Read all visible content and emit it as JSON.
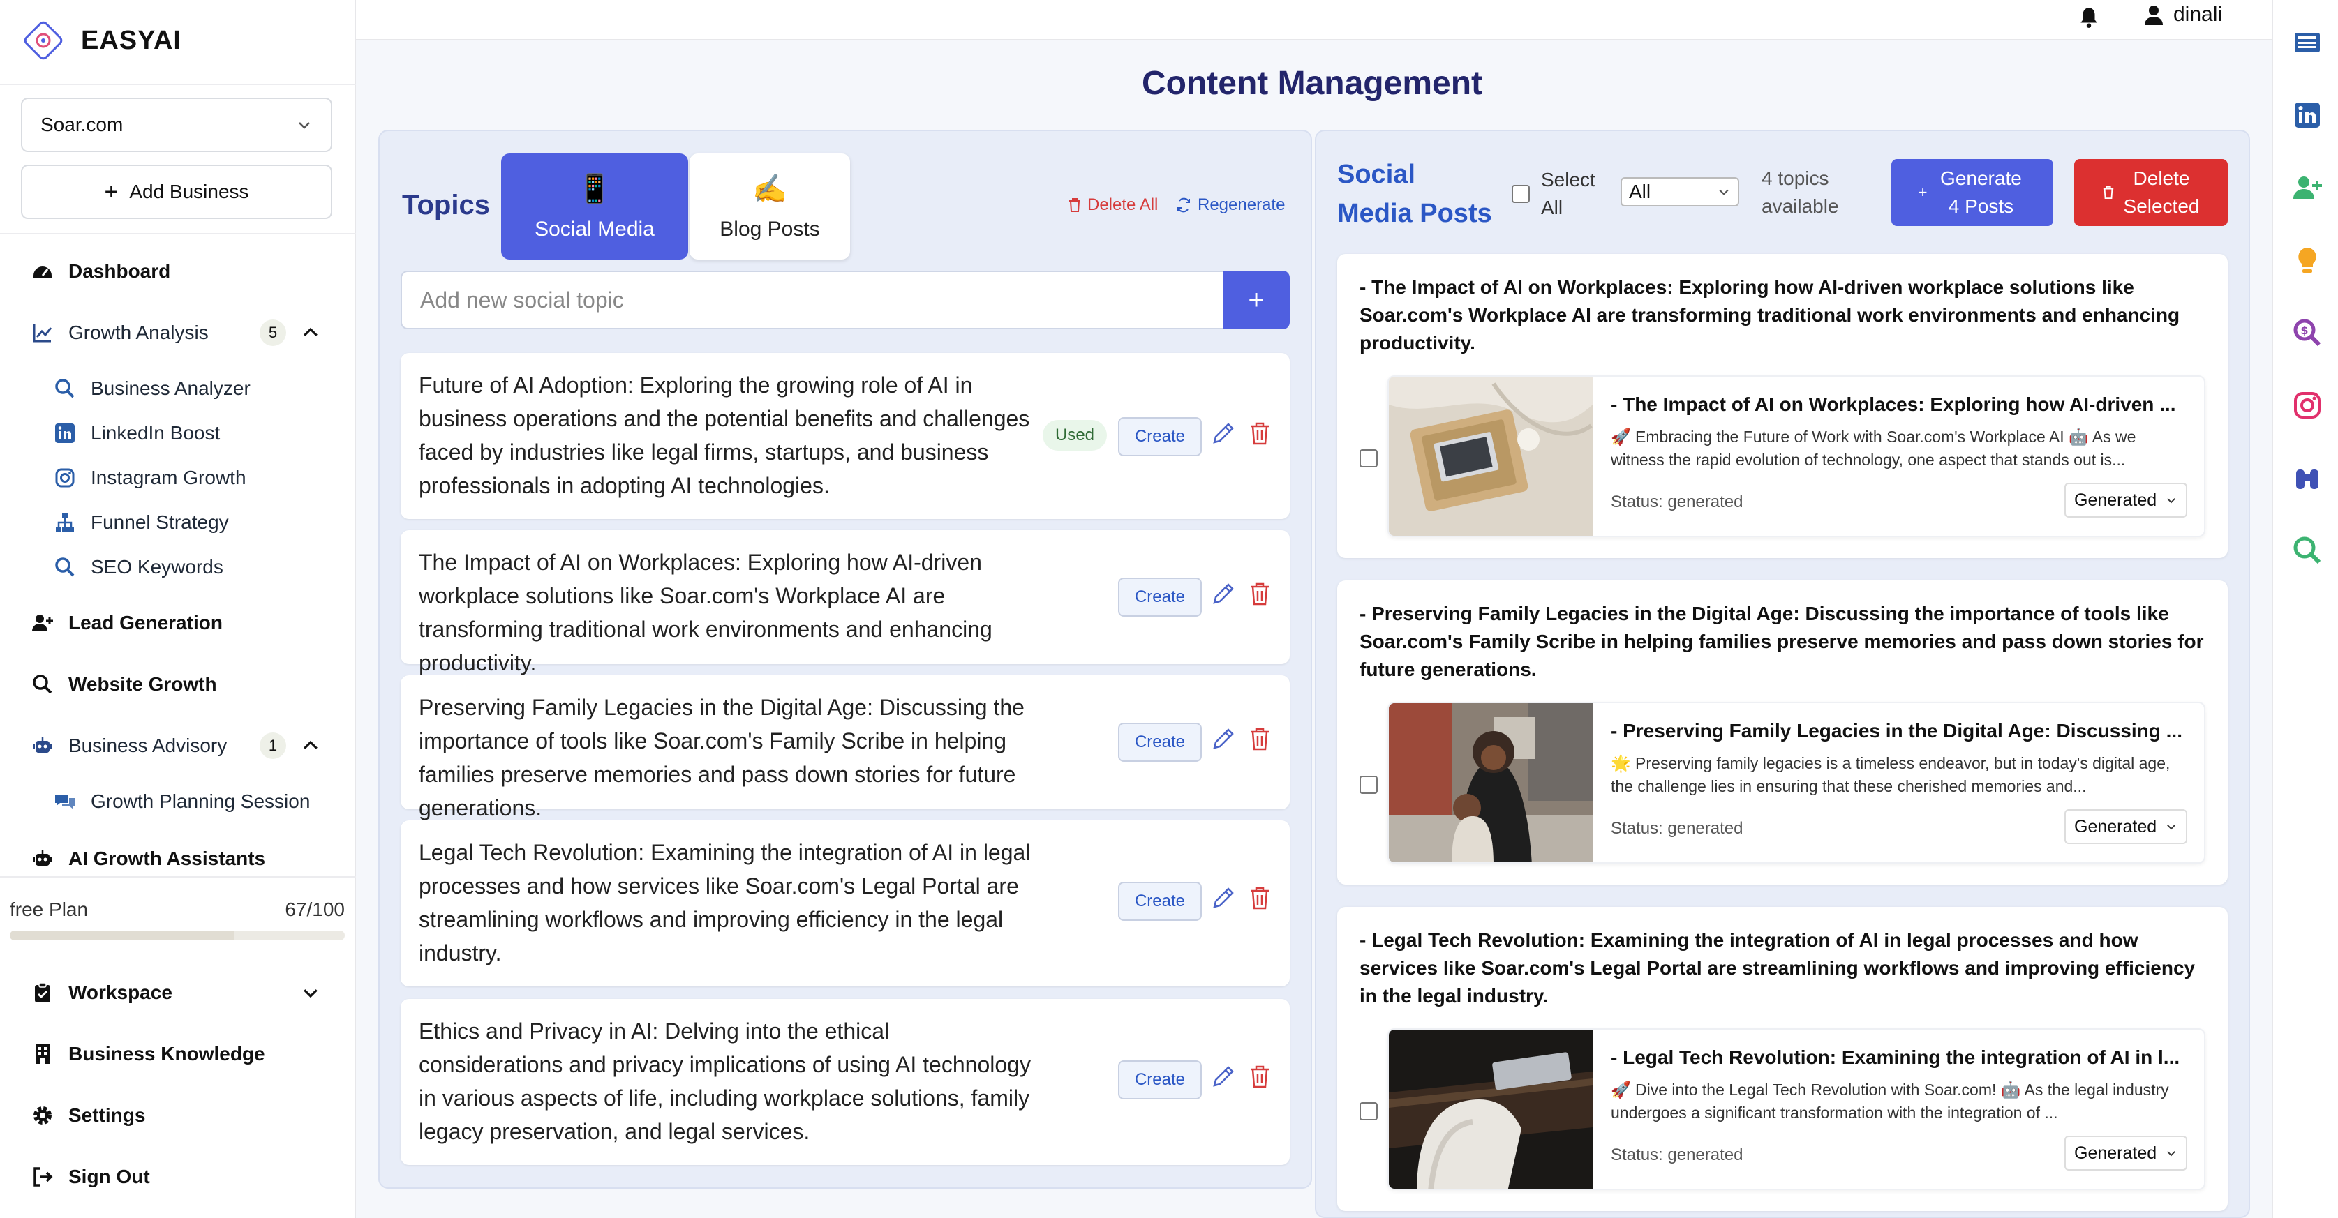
{
  "app": {
    "name": "EASYAI"
  },
  "sidebar": {
    "business_select": "Soar.com",
    "add_business": "Add Business",
    "nav": {
      "dashboard": "Dashboard",
      "growth_analysis": "Growth Analysis",
      "growth_analysis_count": "5",
      "business_analyzer": "Business Analyzer",
      "linkedin_boost": "LinkedIn Boost",
      "instagram_growth": "Instagram Growth",
      "funnel_strategy": "Funnel Strategy",
      "seo_keywords": "SEO Keywords",
      "lead_generation": "Lead Generation",
      "website_growth": "Website Growth",
      "business_advisory": "Business Advisory",
      "business_advisory_count": "1",
      "growth_planning_session": "Growth Planning Session",
      "ai_growth_assistants": "AI Growth Assistants",
      "workspace": "Workspace",
      "business_knowledge": "Business Knowledge",
      "settings": "Settings",
      "sign_out": "Sign Out"
    },
    "plan": {
      "label": "free Plan",
      "usage": "67/100",
      "fraction": 0.67
    }
  },
  "header": {
    "user": "dinali"
  },
  "page": {
    "title": "Content Management"
  },
  "topics": {
    "heading": "Topics",
    "tabs": [
      {
        "icon": "📱",
        "label": "Social Media"
      },
      {
        "icon": "✍️",
        "label": "Blog Posts"
      }
    ],
    "delete_all": "Delete All",
    "regenerate": "Regenerate",
    "input_placeholder": "Add new social topic",
    "add_button": "+",
    "used_label": "Used",
    "create_label": "Create",
    "items": [
      {
        "text": "Future of AI Adoption: Exploring the growing role of AI in business operations and the potential benefits and challenges faced by industries like legal firms, startups, and business professionals in adopting AI technologies."
      },
      {
        "text": "The Impact of AI on Workplaces: Exploring how AI-driven workplace solutions like Soar.com's Workplace AI are transforming traditional work environments and enhancing productivity."
      },
      {
        "text": "Preserving Family Legacies in the Digital Age: Discussing the importance of tools like Soar.com's Family Scribe in helping families preserve memories and pass down stories for future generations."
      },
      {
        "text": "Legal Tech Revolution: Examining the integration of AI in legal processes and how services like Soar.com's Legal Portal are streamlining workflows and improving efficiency in the legal industry."
      },
      {
        "text": "Ethics and Privacy in AI: Delving into the ethical considerations and privacy implications of using AI technology in various aspects of life, including workplace solutions, family legacy preservation, and legal services."
      }
    ]
  },
  "posts": {
    "heading": "Social Media Posts",
    "select_all": "Select All",
    "filter": "All",
    "available": "4 topics available",
    "generate": "Generate 4 Posts",
    "delete_selected": "Delete Selected",
    "status": "Status: generated",
    "status_option": "Generated",
    "items": [
      {
        "topic": "- The Impact of AI on Workplaces: Exploring how AI-driven workplace solutions like Soar.com's Workplace AI are transforming traditional work environments and enhancing productivity.",
        "title": "- The Impact of AI on Workplaces: Exploring how AI-driven ...",
        "body": "🚀 Embracing the Future of Work with Soar.com's Workplace AI 🤖 As we witness the rapid evolution of technology, one aspect that stands out is..."
      },
      {
        "topic": "- Preserving Family Legacies in the Digital Age: Discussing the importance of tools like Soar.com's Family Scribe in helping families preserve memories and pass down stories for future generations.",
        "title": "- Preserving Family Legacies in the Digital Age: Discussing ...",
        "body": "🌟 Preserving family legacies is a timeless endeavor, but in today's digital age, the challenge lies in ensuring that these cherished memories and..."
      },
      {
        "topic": "- Legal Tech Revolution: Examining the integration of AI in legal processes and how services like Soar.com's Legal Portal are streamlining workflows and improving efficiency in the legal industry.",
        "title": "- Legal Tech Revolution: Examining the integration of AI in l...",
        "body": "🚀 Dive into the Legal Tech Revolution with Soar.com! 🤖 As the legal industry undergoes a significant transformation with the integration of ..."
      }
    ]
  },
  "colors": {
    "accent": "#4f5fe0",
    "danger": "#dc3030",
    "title": "#23256b",
    "link": "#2b57c5"
  }
}
